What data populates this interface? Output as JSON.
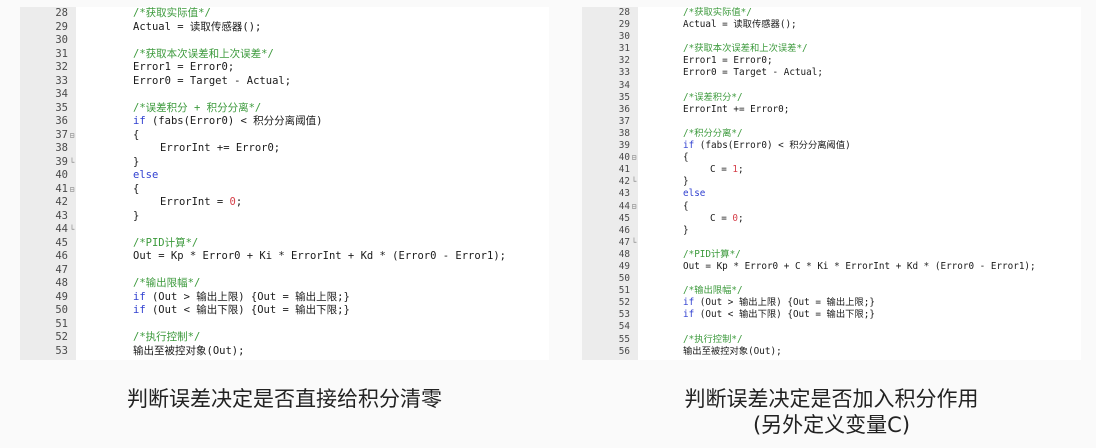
{
  "left_panel": {
    "caption": "判断误差决定是否直接给积分清零",
    "lines": [
      {
        "n": "28",
        "fold": "",
        "indent": 0,
        "tokens": [
          {
            "c": "cm",
            "t": "/*获取实际值*/"
          }
        ]
      },
      {
        "n": "29",
        "fold": "",
        "indent": 0,
        "tokens": [
          {
            "c": "",
            "t": "Actual = 读取传感器();"
          }
        ]
      },
      {
        "n": "30",
        "fold": "",
        "indent": 0,
        "tokens": []
      },
      {
        "n": "31",
        "fold": "",
        "indent": 0,
        "tokens": [
          {
            "c": "cm",
            "t": "/*获取本次误差和上次误差*/"
          }
        ]
      },
      {
        "n": "32",
        "fold": "",
        "indent": 0,
        "tokens": [
          {
            "c": "",
            "t": "Error1 = Error0;"
          }
        ]
      },
      {
        "n": "33",
        "fold": "",
        "indent": 0,
        "tokens": [
          {
            "c": "",
            "t": "Error0 = Target - Actual;"
          }
        ]
      },
      {
        "n": "34",
        "fold": "",
        "indent": 0,
        "tokens": []
      },
      {
        "n": "35",
        "fold": "",
        "indent": 0,
        "tokens": [
          {
            "c": "cm",
            "t": "/*误差积分 + 积分分离*/"
          }
        ]
      },
      {
        "n": "36",
        "fold": "",
        "indent": 0,
        "tokens": [
          {
            "c": "kw",
            "t": "if"
          },
          {
            "c": "",
            "t": " (fabs(Error0) < 积分分离阈值)"
          }
        ]
      },
      {
        "n": "37",
        "fold": "⊟",
        "indent": 0,
        "tokens": [
          {
            "c": "",
            "t": "{"
          }
        ]
      },
      {
        "n": "38",
        "fold": "",
        "indent": 1,
        "tokens": [
          {
            "c": "",
            "t": "ErrorInt += Error0;"
          }
        ]
      },
      {
        "n": "39",
        "fold": "└",
        "indent": 0,
        "tokens": [
          {
            "c": "",
            "t": "}"
          }
        ]
      },
      {
        "n": "40",
        "fold": "",
        "indent": 0,
        "tokens": [
          {
            "c": "kw",
            "t": "else"
          }
        ]
      },
      {
        "n": "41",
        "fold": "⊟",
        "indent": 0,
        "tokens": [
          {
            "c": "",
            "t": "{"
          }
        ]
      },
      {
        "n": "42",
        "fold": "",
        "indent": 1,
        "tokens": [
          {
            "c": "",
            "t": "ErrorInt = "
          },
          {
            "c": "nm",
            "t": "0"
          },
          {
            "c": "",
            "t": ";"
          }
        ]
      },
      {
        "n": "43",
        "fold": "",
        "indent": 0,
        "tokens": [
          {
            "c": "",
            "t": "}"
          }
        ]
      },
      {
        "n": "44",
        "fold": "└",
        "indent": 0,
        "tokens": []
      },
      {
        "n": "45",
        "fold": "",
        "indent": 0,
        "tokens": [
          {
            "c": "cm",
            "t": "/*PID计算*/"
          }
        ]
      },
      {
        "n": "46",
        "fold": "",
        "indent": 0,
        "tokens": [
          {
            "c": "",
            "t": "Out = Kp * Error0 + Ki * ErrorInt + Kd * (Error0 - Error1);"
          }
        ]
      },
      {
        "n": "47",
        "fold": "",
        "indent": 0,
        "tokens": []
      },
      {
        "n": "48",
        "fold": "",
        "indent": 0,
        "tokens": [
          {
            "c": "cm",
            "t": "/*输出限幅*/"
          }
        ]
      },
      {
        "n": "49",
        "fold": "",
        "indent": 0,
        "tokens": [
          {
            "c": "kw",
            "t": "if"
          },
          {
            "c": "",
            "t": " (Out > 输出上限) {Out = 输出上限;}"
          }
        ]
      },
      {
        "n": "50",
        "fold": "",
        "indent": 0,
        "tokens": [
          {
            "c": "kw",
            "t": "if"
          },
          {
            "c": "",
            "t": " (Out < 输出下限) {Out = 输出下限;}"
          }
        ]
      },
      {
        "n": "51",
        "fold": "",
        "indent": 0,
        "tokens": []
      },
      {
        "n": "52",
        "fold": "",
        "indent": 0,
        "tokens": [
          {
            "c": "cm",
            "t": "/*执行控制*/"
          }
        ]
      },
      {
        "n": "53",
        "fold": "",
        "indent": 0,
        "tokens": [
          {
            "c": "",
            "t": "输出至被控对象(Out);"
          }
        ]
      }
    ]
  },
  "right_panel": {
    "caption_line1": "判断误差决定是否加入积分作用",
    "caption_line2": "(另外定义变量C)",
    "lines": [
      {
        "n": "28",
        "fold": "",
        "indent": 0,
        "tokens": [
          {
            "c": "cm",
            "t": "/*获取实际值*/"
          }
        ]
      },
      {
        "n": "29",
        "fold": "",
        "indent": 0,
        "tokens": [
          {
            "c": "",
            "t": "Actual = 读取传感器();"
          }
        ]
      },
      {
        "n": "30",
        "fold": "",
        "indent": 0,
        "tokens": []
      },
      {
        "n": "31",
        "fold": "",
        "indent": 0,
        "tokens": [
          {
            "c": "cm",
            "t": "/*获取本次误差和上次误差*/"
          }
        ]
      },
      {
        "n": "32",
        "fold": "",
        "indent": 0,
        "tokens": [
          {
            "c": "",
            "t": "Error1 = Error0;"
          }
        ]
      },
      {
        "n": "33",
        "fold": "",
        "indent": 0,
        "tokens": [
          {
            "c": "",
            "t": "Error0 = Target - Actual;"
          }
        ]
      },
      {
        "n": "34",
        "fold": "",
        "indent": 0,
        "tokens": []
      },
      {
        "n": "35",
        "fold": "",
        "indent": 0,
        "tokens": [
          {
            "c": "cm",
            "t": "/*误差积分*/"
          }
        ]
      },
      {
        "n": "36",
        "fold": "",
        "indent": 0,
        "tokens": [
          {
            "c": "",
            "t": "ErrorInt += Error0;"
          }
        ]
      },
      {
        "n": "37",
        "fold": "",
        "indent": 0,
        "tokens": []
      },
      {
        "n": "38",
        "fold": "",
        "indent": 0,
        "tokens": [
          {
            "c": "cm",
            "t": "/*积分分离*/"
          }
        ]
      },
      {
        "n": "39",
        "fold": "",
        "indent": 0,
        "tokens": [
          {
            "c": "kw",
            "t": "if"
          },
          {
            "c": "",
            "t": " (fabs(Error0) < 积分分离阈值)"
          }
        ]
      },
      {
        "n": "40",
        "fold": "⊟",
        "indent": 0,
        "tokens": [
          {
            "c": "",
            "t": "{"
          }
        ]
      },
      {
        "n": "41",
        "fold": "",
        "indent": 1,
        "tokens": [
          {
            "c": "",
            "t": "C = "
          },
          {
            "c": "nm",
            "t": "1"
          },
          {
            "c": "",
            "t": ";"
          }
        ]
      },
      {
        "n": "42",
        "fold": "└",
        "indent": 0,
        "tokens": [
          {
            "c": "",
            "t": "}"
          }
        ]
      },
      {
        "n": "43",
        "fold": "",
        "indent": 0,
        "tokens": [
          {
            "c": "kw",
            "t": "else"
          }
        ]
      },
      {
        "n": "44",
        "fold": "⊟",
        "indent": 0,
        "tokens": [
          {
            "c": "",
            "t": "{"
          }
        ]
      },
      {
        "n": "45",
        "fold": "",
        "indent": 1,
        "tokens": [
          {
            "c": "",
            "t": "C = "
          },
          {
            "c": "nm",
            "t": "0"
          },
          {
            "c": "",
            "t": ";"
          }
        ]
      },
      {
        "n": "46",
        "fold": "",
        "indent": 0,
        "tokens": [
          {
            "c": "",
            "t": "}"
          }
        ]
      },
      {
        "n": "47",
        "fold": "└",
        "indent": 0,
        "tokens": []
      },
      {
        "n": "48",
        "fold": "",
        "indent": 0,
        "tokens": [
          {
            "c": "cm",
            "t": "/*PID计算*/"
          }
        ]
      },
      {
        "n": "49",
        "fold": "",
        "indent": 0,
        "tokens": [
          {
            "c": "",
            "t": "Out = Kp * Error0 + C * Ki * ErrorInt + Kd * (Error0 - Error1);"
          }
        ]
      },
      {
        "n": "50",
        "fold": "",
        "indent": 0,
        "tokens": []
      },
      {
        "n": "51",
        "fold": "",
        "indent": 0,
        "tokens": [
          {
            "c": "cm",
            "t": "/*输出限幅*/"
          }
        ]
      },
      {
        "n": "52",
        "fold": "",
        "indent": 0,
        "tokens": [
          {
            "c": "kw",
            "t": "if"
          },
          {
            "c": "",
            "t": " (Out > 输出上限) {Out = 输出上限;}"
          }
        ]
      },
      {
        "n": "53",
        "fold": "",
        "indent": 0,
        "tokens": [
          {
            "c": "kw",
            "t": "if"
          },
          {
            "c": "",
            "t": " (Out < 输出下限) {Out = 输出下限;}"
          }
        ]
      },
      {
        "n": "54",
        "fold": "",
        "indent": 0,
        "tokens": []
      },
      {
        "n": "55",
        "fold": "",
        "indent": 0,
        "tokens": [
          {
            "c": "cm",
            "t": "/*执行控制*/"
          }
        ]
      },
      {
        "n": "56",
        "fold": "",
        "indent": 0,
        "tokens": [
          {
            "c": "",
            "t": "输出至被控对象(Out);"
          }
        ]
      }
    ]
  },
  "colors": {
    "comment": "#3c9a3c",
    "keyword": "#2f3fd0",
    "number": "#d6404a",
    "gutter": "#ececec"
  }
}
